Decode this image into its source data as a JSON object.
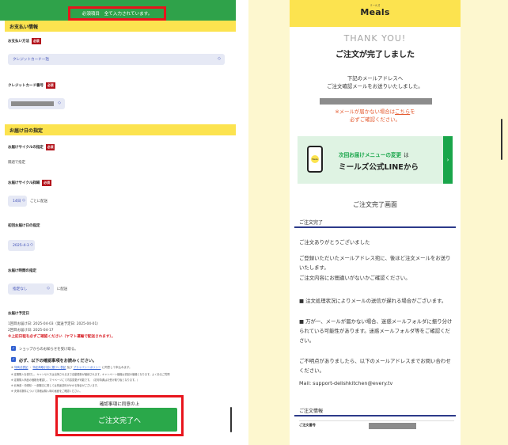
{
  "left": {
    "notice": "必須項目　全て入力されています。",
    "payment": {
      "section_title": "お支払い情報",
      "method_label": "お支払い方法",
      "method_value": "クレジットカード一括",
      "card_label": "クレジットカード番号"
    },
    "required_badge": "必須",
    "delivery": {
      "section_title": "お届け日の指定",
      "cycle_label": "お届けサイクルの指定",
      "cycle_value": "隔週で指定",
      "cycle_detail_label": "お届けサイクル詳細",
      "cycle_detail_value": "14日",
      "cycle_detail_suffix": "ごとに配送",
      "first_date_label": "初回お届け日の指定",
      "first_date_value": "2025-4-3",
      "time_label": "お届け時間の指定",
      "time_value": "指定なし",
      "time_suffix": "に配送",
      "schedule_label": "お届け予定日",
      "schedule_line1": "1回目お届け日: 2025-04-03（発送予定日: 2025-04-01）",
      "schedule_line2": "2回目お届け日: 2025-04-17",
      "schedule_warning": "※上記日程を必ずご確認ください（ヤマト運輸で配送されます）。"
    },
    "shop_notice": "ショップからのお知らせを受け取る。",
    "confirm_heading": "必ず、以下の確認事項をお読みください。",
    "note1_prefix": "※",
    "note1_link1": "特商法表記",
    "note1_mid": "・",
    "note1_link2": "特定商取引法に基づく表記",
    "note1_and": "及び",
    "note1_link3": "プライバシーポリシー",
    "note1_suffix": "に同意して申込みます。",
    "note2": "※ 定期購入を受付し、キャンセル又は出荷されるまで自動更新が継続されます。キャンペーン価格は初回の価格となります。よくあるご質問",
    "note3": "※ 定期購入商品の価格を確認し、マイページにて内容変更が可能です。（初月特典はお受け取り後となります。）",
    "note4": "※ 北海道・沖縄県・一部離島に関しては別途送料がかかる場合がございます。",
    "note5": "※ 決済手数料について詳細は購入時の画面をご確認ください。",
    "cta_caption": "確認事項に同意の上",
    "cta_button": "ご注文完了へ"
  },
  "right": {
    "logo_sub": "ミールズ",
    "logo": "Meals",
    "thank_you": "THANK YOU!",
    "done_title": "ご注文が完了しました",
    "mail_msg_line1": "下記のメールアドレスへ",
    "mail_msg_line2": "ご注文確認メールをお送りいたしました。",
    "warn_line1_prefix": "※メールが届かない場合は",
    "warn_line1_link": "こちら",
    "warn_line1_suffix": "を",
    "warn_line2": "必ずご確認ください。",
    "banner": {
      "phone_badge": "Meals",
      "line1": "次回お届けメニューの変更",
      "line1_suffix": "は",
      "line2": "ミールズ公式LINEから",
      "arrow": "›"
    },
    "completion_screen": "ご注文完了画面",
    "order_done_bar": "ご注文完了",
    "thanks_line": "ご注文ありがとうございました",
    "body_para1": "ご登録いただいたメールアドレス宛に、後ほど注文メールをお送りいたします。",
    "body_para2": "ご注文内容にお間違いがないかご確認ください。",
    "body_para3": "■ 注文処理状況によりメールの送信が遅れる場合がございます。",
    "body_para4": "■ 万が一、メールが届かない場合、迷惑メールフォルダに振り分けられている可能性があります。迷惑メールフォルダ等をご確認ください。",
    "body_para5": "ご不明点がありましたら、以下のメールアドレスまでお問い合わせください。",
    "mail_contact": "Mail: support-delishkitchen@every.tv",
    "order_info_bar": "ご注文情報",
    "order_no_label": "ご注文番号"
  },
  "colors": {
    "green": "#2fa24a",
    "yellow": "#fce34f",
    "red": "#e8141c",
    "navy": "#2c3a8a"
  }
}
